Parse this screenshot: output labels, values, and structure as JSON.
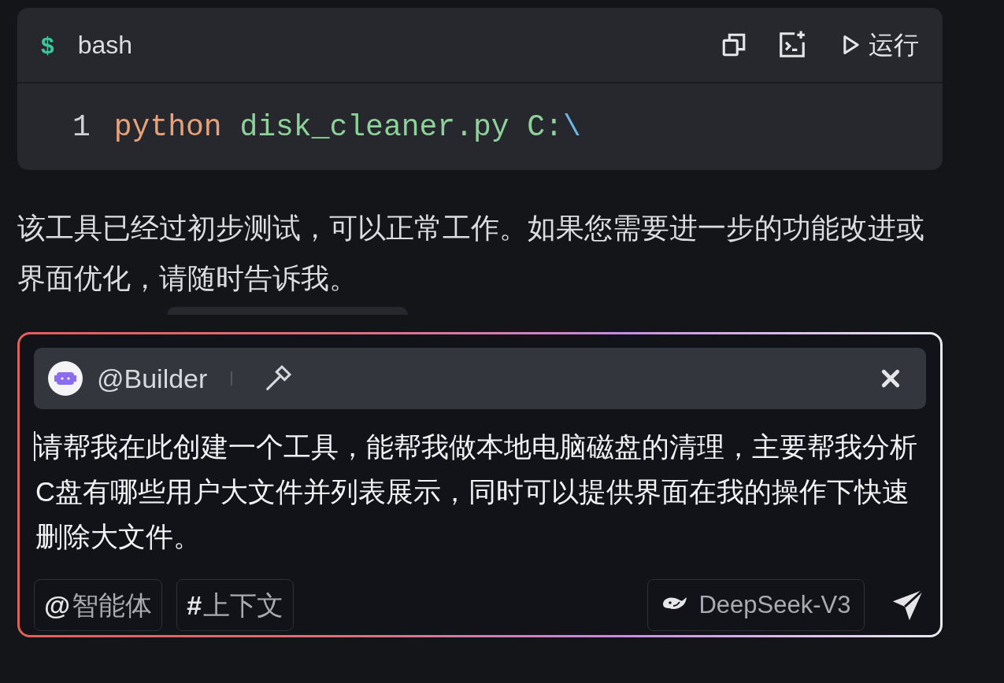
{
  "code_block": {
    "prompt": "$",
    "language": "bash",
    "run_label": "运行",
    "lines": [
      {
        "number": "1",
        "tokens": [
          {
            "kind": "command",
            "text": "python "
          },
          {
            "kind": "string",
            "text": "disk_cleaner.py C:"
          },
          {
            "kind": "escape",
            "text": "\\"
          }
        ]
      }
    ]
  },
  "message": "该工具已经过初步测试，可以正常工作。如果您需要进一步的功能改进或界面优化，请随时告诉我。",
  "composer": {
    "agent": "@Builder",
    "value": "请帮我在此创建一个工具，能帮我做本地电脑磁盘的清理，主要帮我分析C盘有哪些用户大文件并列表展示，同时可以提供界面在我的操作下快速删除大文件。",
    "chips": [
      {
        "symbol": "@",
        "label": "智能体"
      },
      {
        "symbol": "#",
        "label": "上下文"
      }
    ],
    "model": "DeepSeek-V3"
  }
}
